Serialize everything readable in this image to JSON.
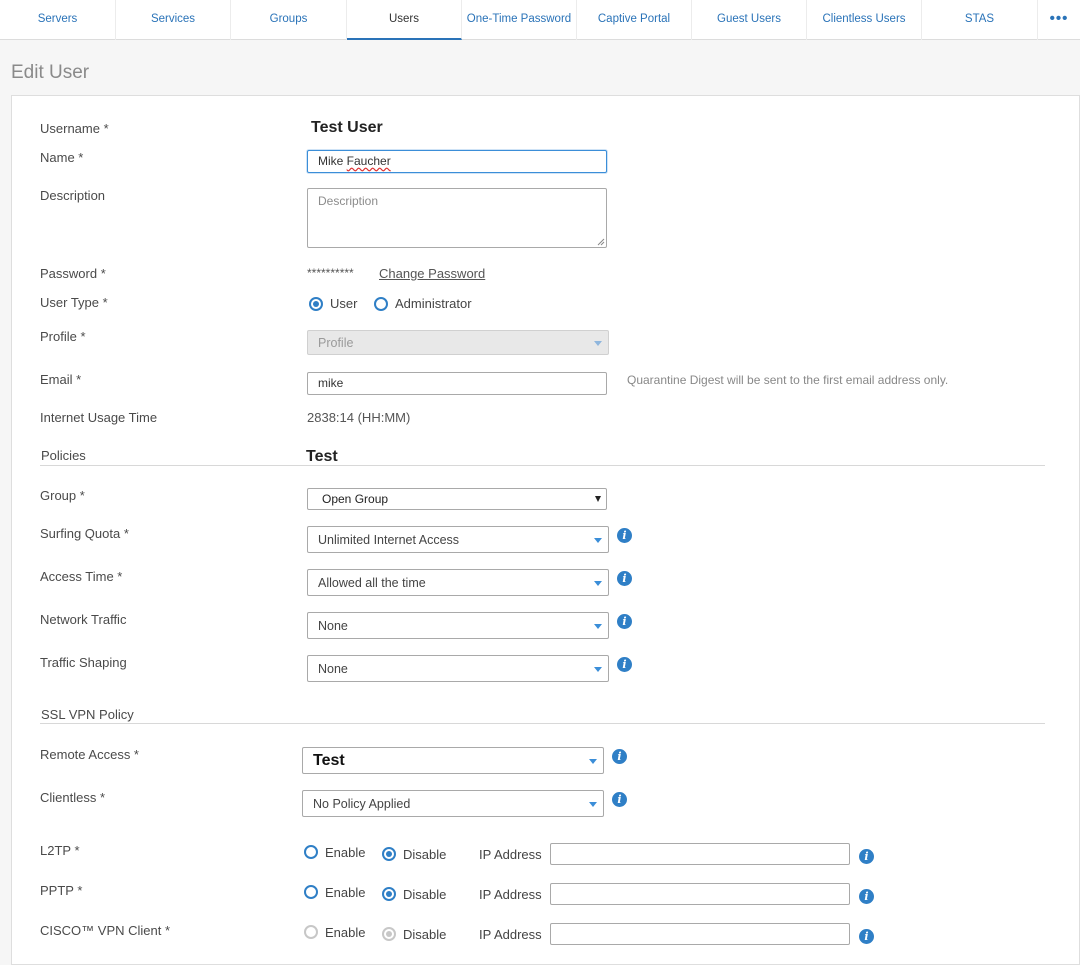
{
  "tabs": [
    {
      "label": "Servers"
    },
    {
      "label": "Services"
    },
    {
      "label": "Groups"
    },
    {
      "label": "Users"
    },
    {
      "label": "One-Time Password"
    },
    {
      "label": "Captive Portal"
    },
    {
      "label": "Guest Users"
    },
    {
      "label": "Clientless Users"
    },
    {
      "label": "STAS"
    },
    {
      "label": "•••"
    }
  ],
  "active_tab": "Users",
  "page_title": "Edit User",
  "form": {
    "username": {
      "label": "Username *",
      "value": "Test User"
    },
    "name": {
      "label": "Name *",
      "first": "Mike ",
      "last": "Faucher"
    },
    "description": {
      "label": "Description",
      "placeholder": "Description"
    },
    "password": {
      "label": "Password *",
      "masked": "**********",
      "link": "Change Password"
    },
    "user_type": {
      "label": "User Type *",
      "options": [
        "User",
        "Administrator"
      ],
      "selected": "User"
    },
    "profile": {
      "label": "Profile *",
      "placeholder": "Profile"
    },
    "email": {
      "label": "Email *",
      "value": "mike",
      "note": "Quarantine Digest will be sent to the first email address only."
    },
    "internet_usage": {
      "label": "Internet Usage Time",
      "value": "2838:14 (HH:MM)"
    }
  },
  "policies": {
    "section_label": "Policies",
    "section_value": "Test",
    "group": {
      "label": "Group *",
      "value": "Open Group"
    },
    "surfing_quota": {
      "label": "Surfing Quota *",
      "value": "Unlimited Internet Access"
    },
    "access_time": {
      "label": "Access Time *",
      "value": "Allowed all the time"
    },
    "network_traffic": {
      "label": "Network Traffic",
      "value": "None"
    },
    "traffic_shaping": {
      "label": "Traffic Shaping",
      "value": "None"
    }
  },
  "ssl_vpn": {
    "section_label": "SSL VPN Policy",
    "remote_access": {
      "label": "Remote Access *",
      "value": "Test"
    },
    "clientless": {
      "label": "Clientless *",
      "value": "No Policy Applied"
    }
  },
  "vpn_rows": [
    {
      "label": "L2TP *",
      "enable": "Enable",
      "disable": "Disable",
      "selected": "Disable",
      "ip_label": "IP Address",
      "disabled": false
    },
    {
      "label": "PPTP *",
      "enable": "Enable",
      "disable": "Disable",
      "selected": "Disable",
      "ip_label": "IP Address",
      "disabled": false
    },
    {
      "label": "CISCO™ VPN Client *",
      "enable": "Enable",
      "disable": "Disable",
      "selected": "Disable",
      "ip_label": "IP Address",
      "disabled": true
    }
  ],
  "colors": {
    "accent": "#2f7fc6",
    "tab_text": "#2a73b8"
  },
  "icons": {
    "info": "info-icon",
    "dropdown": "chevron-down-icon"
  }
}
